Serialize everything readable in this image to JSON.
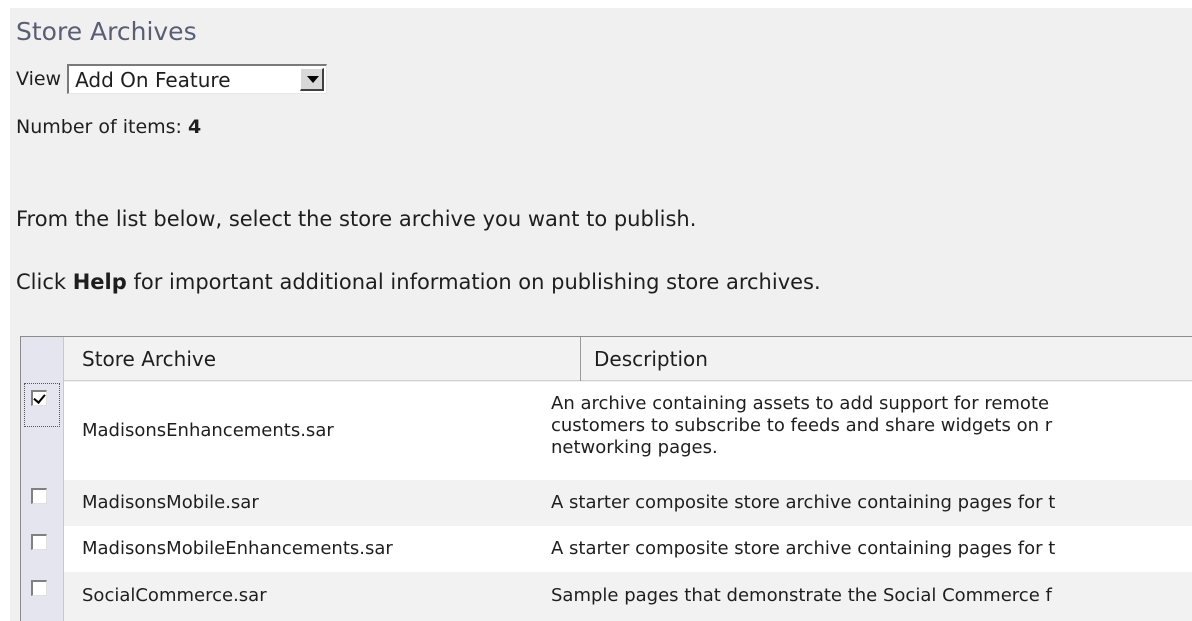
{
  "page": {
    "title": "Store Archives",
    "view_label": "View",
    "view_selected": "Add On Feature",
    "count_label": "Number of items:",
    "count_value": "4",
    "instruction": "From the list below, select the store archive you want to publish.",
    "help_prefix": "Click",
    "help_word": "Help",
    "help_suffix": "for important additional information on publishing store archives."
  },
  "table": {
    "columns": [
      "Store Archive",
      "Description"
    ],
    "rows": [
      {
        "checked": true,
        "name": "MadisonsEnhancements.sar",
        "description_lines": [
          "An archive containing assets to add support for remote",
          "customers to subscribe to feeds and share widgets on r",
          "networking pages."
        ]
      },
      {
        "checked": false,
        "name": "MadisonsMobile.sar",
        "description_lines": [
          "A starter composite store archive containing pages for t"
        ]
      },
      {
        "checked": false,
        "name": "MadisonsMobileEnhancements.sar",
        "description_lines": [
          "A starter composite store archive containing pages for t"
        ]
      },
      {
        "checked": false,
        "name": "SocialCommerce.sar",
        "description_lines": [
          "Sample pages that demonstrate the Social Commerce f"
        ]
      }
    ]
  }
}
